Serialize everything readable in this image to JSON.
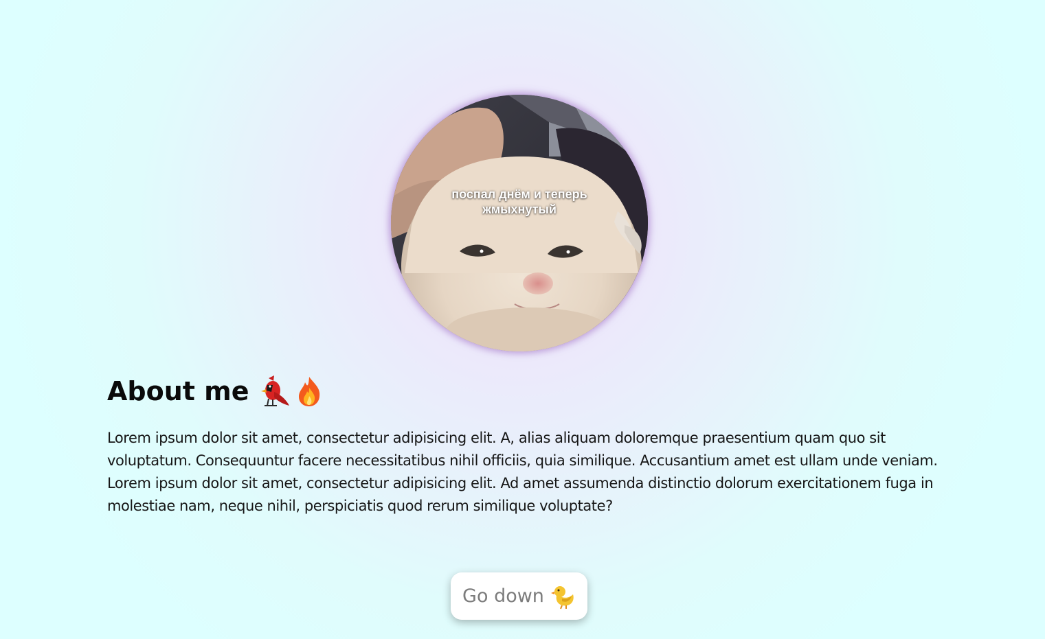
{
  "avatar": {
    "caption_line1": "поспал днём и теперь",
    "caption_line2": "жмыхнутый"
  },
  "about": {
    "title": "About me",
    "title_icons": [
      "cardinal-bird-icon",
      "fire-icon"
    ],
    "paragraph": "Lorem ipsum dolor sit amet, consectetur adipisicing elit. A, alias aliquam doloremque praesentium quam quo sit voluptatum. Consequuntur facere necessitatibus nihil officiis, quia similique. Accusantium amet est ullam unde veniam. Lorem ipsum dolor sit amet, consectetur adipisicing elit. Ad amet assumenda distinctio dolorum exercitationem fuga in molestiae nam, neque nihil, perspiciatis quod rerum similique voluptate?"
  },
  "cta": {
    "label": "Go down",
    "icon": "chick-icon"
  },
  "colors": {
    "background": "#ddffff",
    "avatar_glow": "#965fbe",
    "button_text": "#7c7c7c"
  }
}
